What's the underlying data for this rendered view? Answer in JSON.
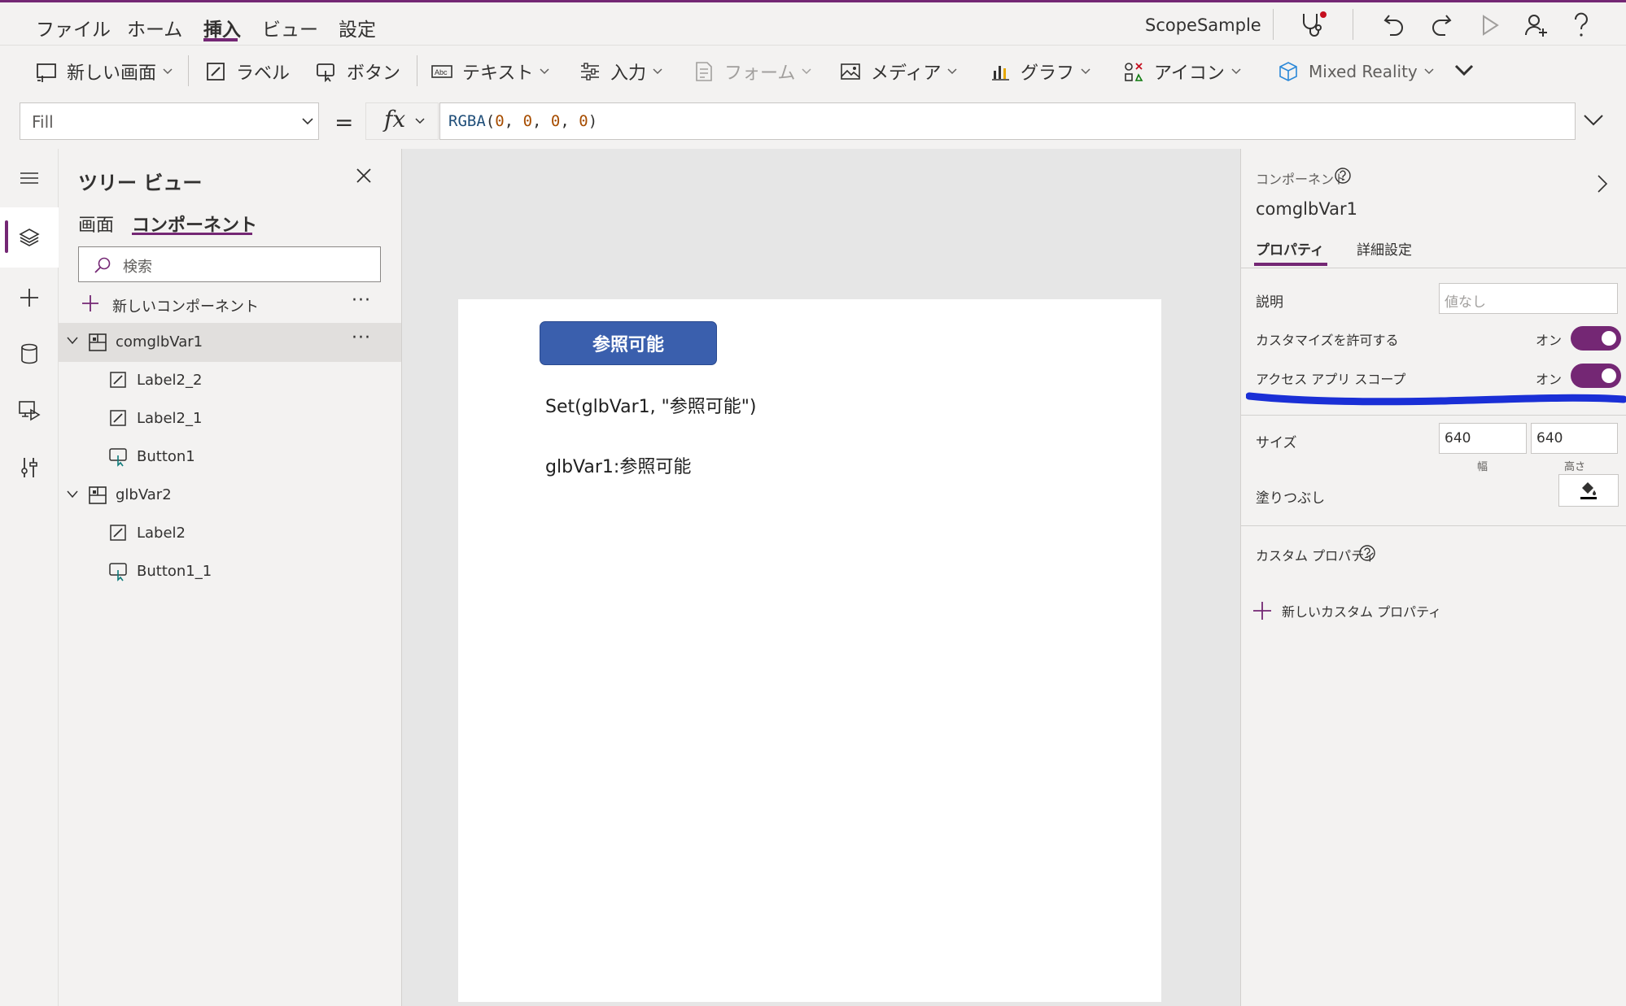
{
  "menu": {
    "items": [
      "ファイル",
      "ホーム",
      "挿入",
      "ビュー",
      "設定"
    ],
    "active": "挿入",
    "app_name": "ScopeSample"
  },
  "ribbon": {
    "new_screen": "新しい画面",
    "label": "ラベル",
    "button": "ボタン",
    "text": "テキスト",
    "input": "入力",
    "form": "フォーム",
    "media": "メディア",
    "chart": "グラフ",
    "icon": "アイコン",
    "mixed_reality": "Mixed Reality"
  },
  "formula": {
    "property": "Fill",
    "equals": "=",
    "fx": "fx",
    "fn": "RGBA",
    "args": [
      "0",
      "0",
      "0",
      "0"
    ]
  },
  "tree": {
    "title": "ツリー ビュー",
    "tabs": [
      "画面",
      "コンポーネント"
    ],
    "active_tab": "コンポーネント",
    "search_placeholder": "検索",
    "new_component": "新しいコンポーネント",
    "more": "···",
    "items": [
      {
        "label": "comglbVar1",
        "type": "component",
        "selected": true
      },
      {
        "label": "Label2_2",
        "type": "label"
      },
      {
        "label": "Label2_1",
        "type": "label"
      },
      {
        "label": "Button1",
        "type": "button"
      },
      {
        "label": "glbVar2",
        "type": "component"
      },
      {
        "label": "Label2",
        "type": "label"
      },
      {
        "label": "Button1_1",
        "type": "button"
      }
    ]
  },
  "canvas": {
    "button_text": "参照可能",
    "label1": "Set(glbVar1, \"参照可能\")",
    "label2": "glbVar1:参照可能"
  },
  "properties": {
    "section": "コンポーネント",
    "name": "comglbVar1",
    "tabs": [
      "プロパティ",
      "詳細設定"
    ],
    "active_tab": "プロパティ",
    "description_label": "説明",
    "description_placeholder": "値なし",
    "allow_customize_label": "カスタマイズを許可する",
    "allow_customize_state": "オン",
    "access_scope_label": "アクセス アプリ スコープ",
    "access_scope_state": "オン",
    "size_label": "サイズ",
    "width": "640",
    "height": "640",
    "width_caption": "幅",
    "height_caption": "高さ",
    "fill_label": "塗りつぶし",
    "custom_props_label": "カスタム プロパティ",
    "new_custom_prop": "新しいカスタム プロパティ"
  },
  "colors": {
    "accent": "#742774",
    "canvas_button": "#3a5fad",
    "annotation": "#1a2fd6"
  }
}
